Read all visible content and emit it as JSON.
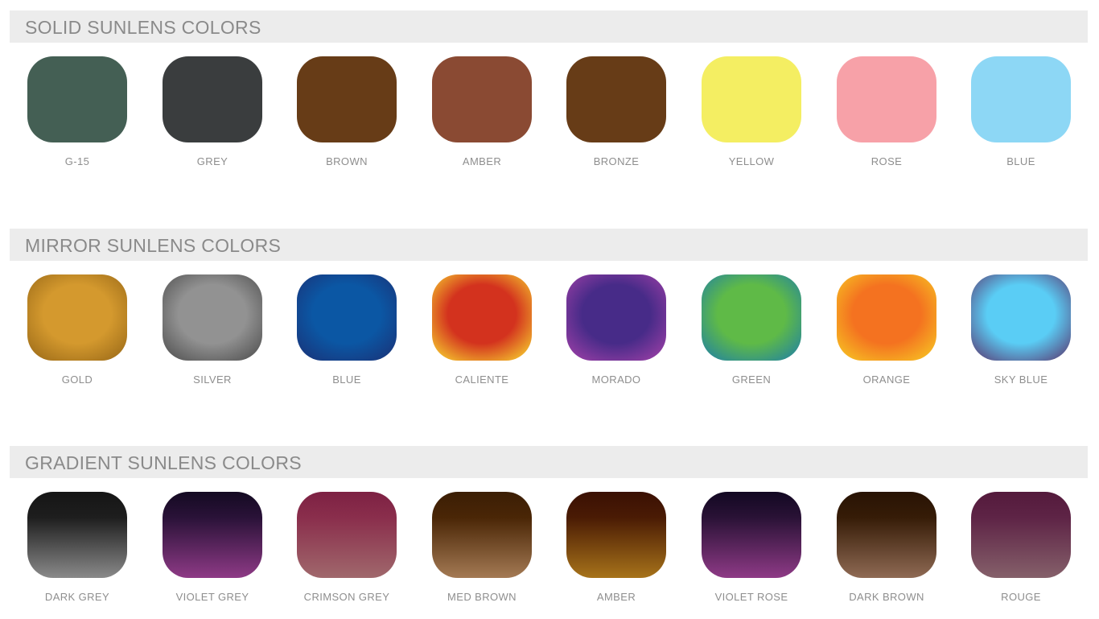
{
  "sections": [
    {
      "title": "SOLID SUNLENS COLORS",
      "style": "solid",
      "swatches": [
        {
          "label": "G-15",
          "colors": [
            "#445f54"
          ]
        },
        {
          "label": "GREY",
          "colors": [
            "#3a3d3e"
          ]
        },
        {
          "label": "BROWN",
          "colors": [
            "#673c17"
          ]
        },
        {
          "label": "AMBER",
          "colors": [
            "#8a4a33"
          ]
        },
        {
          "label": "BRONZE",
          "colors": [
            "#673c17"
          ]
        },
        {
          "label": "YELLOW",
          "colors": [
            "#f4ee62"
          ]
        },
        {
          "label": "ROSE",
          "colors": [
            "#f7a1a8"
          ]
        },
        {
          "label": "BLUE",
          "colors": [
            "#8dd7f5"
          ]
        }
      ]
    },
    {
      "title": "MIRROR SUNLENS COLORS",
      "style": "mirror",
      "swatches": [
        {
          "label": "GOLD",
          "colors": [
            "#d4992e",
            "#a8751d"
          ]
        },
        {
          "label": "SILVER",
          "colors": [
            "#929292",
            "#5f5f5f"
          ]
        },
        {
          "label": "BLUE",
          "colors": [
            "#0b57a4",
            "#163b82"
          ]
        },
        {
          "label": "CALIENTE",
          "colors": [
            "#d3321e",
            "#efae2b"
          ]
        },
        {
          "label": "MORADO",
          "colors": [
            "#472b88",
            "#8b3ba0"
          ]
        },
        {
          "label": "GREEN",
          "colors": [
            "#5fba47",
            "#2f8e8e"
          ]
        },
        {
          "label": "ORANGE",
          "colors": [
            "#f47220",
            "#f6b322"
          ]
        },
        {
          "label": "SKY BLUE",
          "colors": [
            "#5acdf5",
            "#5a5e92"
          ]
        }
      ]
    },
    {
      "title": "GRADIENT SUNLENS COLORS",
      "style": "gradient",
      "swatches": [
        {
          "label": "DARK GREY",
          "colors": [
            "#151515",
            "#1e1e1e",
            "#8a8a8a"
          ]
        },
        {
          "label": "VIOLET GREY",
          "colors": [
            "#140a22",
            "#2a1238",
            "#8e3a86"
          ]
        },
        {
          "label": "CRIMSON GREY",
          "colors": [
            "#7d2143",
            "#8a2e4c",
            "#a0686c"
          ]
        },
        {
          "label": "MED BROWN",
          "colors": [
            "#3b1e05",
            "#4a2606",
            "#a47a54"
          ]
        },
        {
          "label": "AMBER",
          "colors": [
            "#3a1003",
            "#4a1b04",
            "#a7731a"
          ]
        },
        {
          "label": "VIOLET ROSE",
          "colors": [
            "#120822",
            "#2a1236",
            "#8e3a86"
          ]
        },
        {
          "label": "DARK BROWN",
          "colors": [
            "#281304",
            "#361c07",
            "#8f6a54"
          ]
        },
        {
          "label": "ROUGE",
          "colors": [
            "#541a3c",
            "#5e2446",
            "#85606a"
          ]
        }
      ]
    }
  ]
}
